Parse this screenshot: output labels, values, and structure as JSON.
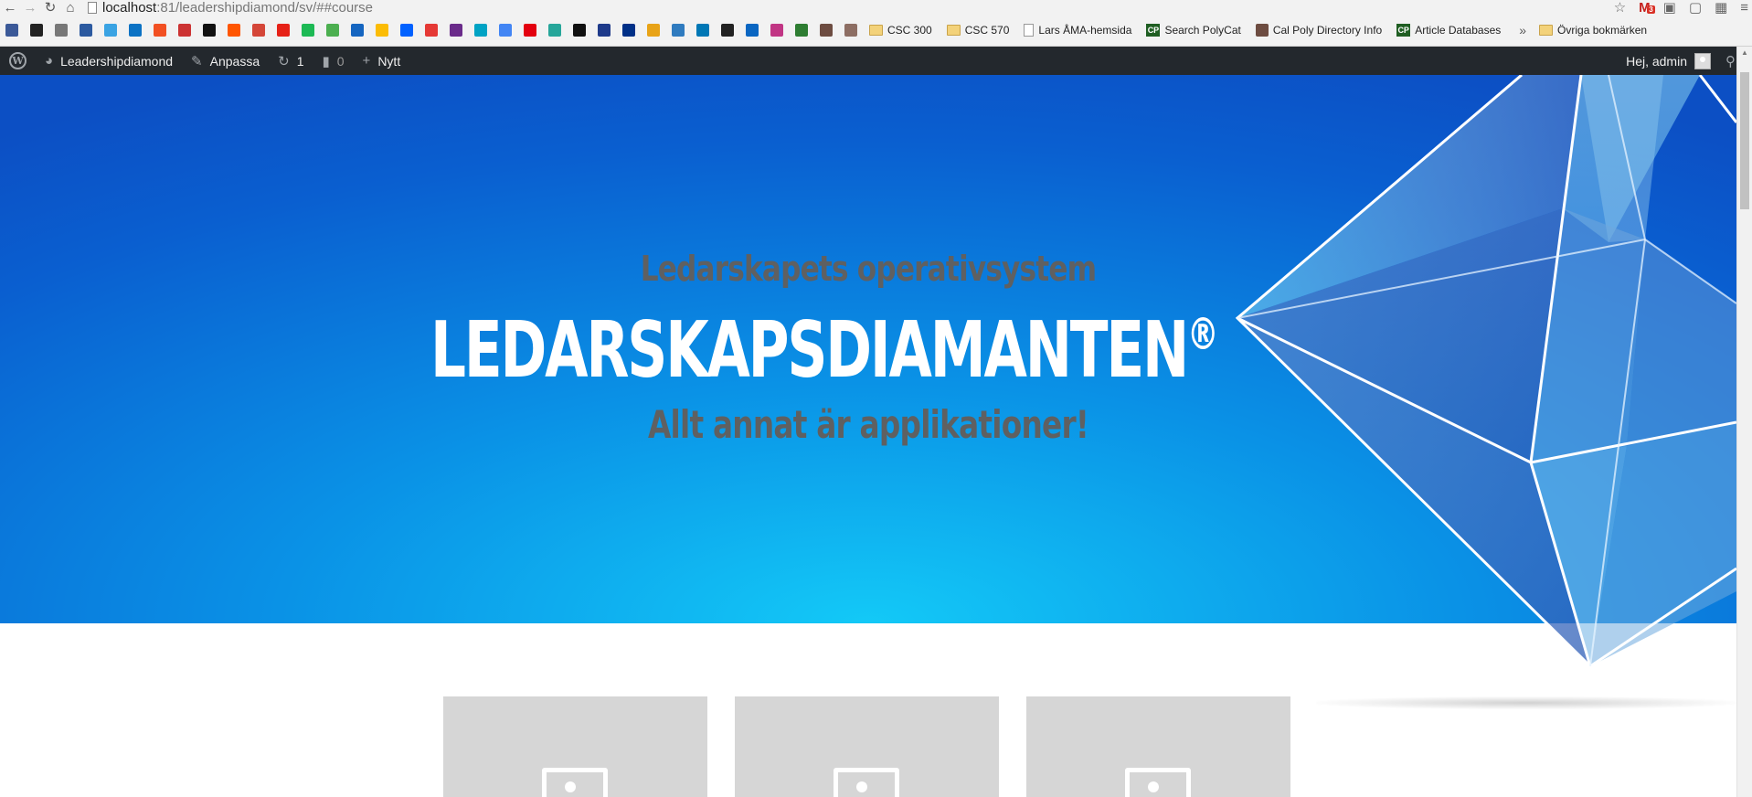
{
  "browser": {
    "url_host": "localhost",
    "url_path": ":81/leadershipdiamond/sv/##course",
    "gmail_badge": "3",
    "bookmarks": [
      {
        "label": "CSC 300",
        "icon": "folder-icon"
      },
      {
        "label": "CSC 570",
        "icon": "folder-icon"
      },
      {
        "label": "Lars ÅMA-hemsida",
        "icon": "page-icon"
      },
      {
        "label": "Search PolyCat",
        "icon": "cp-icon"
      },
      {
        "label": "Cal Poly Directory Info",
        "icon": "cp-icon"
      },
      {
        "label": "Article Databases",
        "icon": "cp-icon"
      }
    ],
    "other_bookmarks": "Övriga bokmärken"
  },
  "admin_bar": {
    "site_name": "Leadershipdiamond",
    "customize": "Anpassa",
    "updates_count": "1",
    "comments_count": "0",
    "new_label": "Nytt",
    "greeting": "Hej, admin"
  },
  "hero": {
    "tagline": "Ledarskapets operativsystem",
    "title": "LEDARSKAPSDIAMANTEN",
    "title_mark": "®",
    "subtagline": "Allt annat är applikationer!"
  },
  "colors": {
    "hero_center": "#13c9f7",
    "hero_edge": "#0c4fc4",
    "admin_bar": "#23282d",
    "tagline_gray": "#5f6061"
  },
  "cards": [
    {
      "icon": "image-placeholder-icon"
    },
    {
      "icon": "image-placeholder-icon"
    },
    {
      "icon": "image-placeholder-icon"
    }
  ]
}
